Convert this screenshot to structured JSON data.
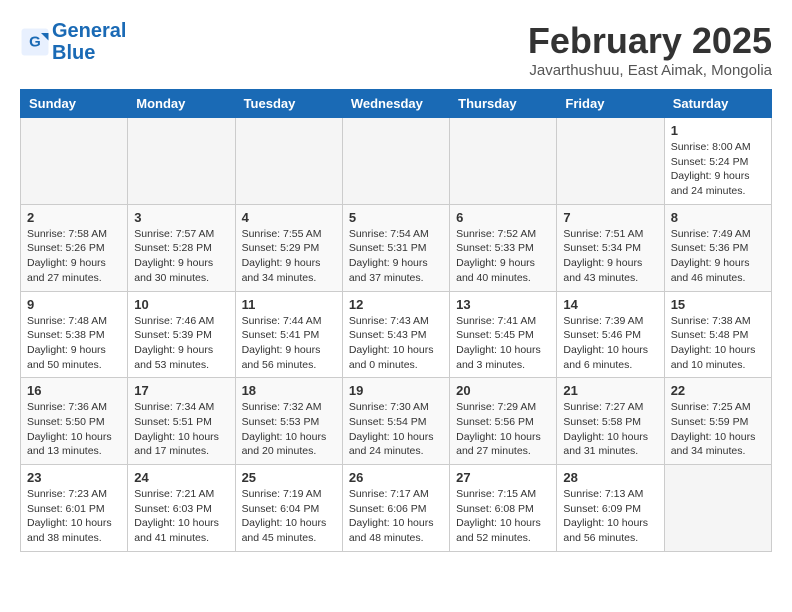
{
  "header": {
    "logo_line1": "General",
    "logo_line2": "Blue",
    "title": "February 2025",
    "subtitle": "Javarthushuu, East Aimak, Mongolia"
  },
  "weekdays": [
    "Sunday",
    "Monday",
    "Tuesday",
    "Wednesday",
    "Thursday",
    "Friday",
    "Saturday"
  ],
  "weeks": [
    [
      {
        "day": "",
        "info": ""
      },
      {
        "day": "",
        "info": ""
      },
      {
        "day": "",
        "info": ""
      },
      {
        "day": "",
        "info": ""
      },
      {
        "day": "",
        "info": ""
      },
      {
        "day": "",
        "info": ""
      },
      {
        "day": "1",
        "info": "Sunrise: 8:00 AM\nSunset: 5:24 PM\nDaylight: 9 hours and 24 minutes."
      }
    ],
    [
      {
        "day": "2",
        "info": "Sunrise: 7:58 AM\nSunset: 5:26 PM\nDaylight: 9 hours and 27 minutes."
      },
      {
        "day": "3",
        "info": "Sunrise: 7:57 AM\nSunset: 5:28 PM\nDaylight: 9 hours and 30 minutes."
      },
      {
        "day": "4",
        "info": "Sunrise: 7:55 AM\nSunset: 5:29 PM\nDaylight: 9 hours and 34 minutes."
      },
      {
        "day": "5",
        "info": "Sunrise: 7:54 AM\nSunset: 5:31 PM\nDaylight: 9 hours and 37 minutes."
      },
      {
        "day": "6",
        "info": "Sunrise: 7:52 AM\nSunset: 5:33 PM\nDaylight: 9 hours and 40 minutes."
      },
      {
        "day": "7",
        "info": "Sunrise: 7:51 AM\nSunset: 5:34 PM\nDaylight: 9 hours and 43 minutes."
      },
      {
        "day": "8",
        "info": "Sunrise: 7:49 AM\nSunset: 5:36 PM\nDaylight: 9 hours and 46 minutes."
      }
    ],
    [
      {
        "day": "9",
        "info": "Sunrise: 7:48 AM\nSunset: 5:38 PM\nDaylight: 9 hours and 50 minutes."
      },
      {
        "day": "10",
        "info": "Sunrise: 7:46 AM\nSunset: 5:39 PM\nDaylight: 9 hours and 53 minutes."
      },
      {
        "day": "11",
        "info": "Sunrise: 7:44 AM\nSunset: 5:41 PM\nDaylight: 9 hours and 56 minutes."
      },
      {
        "day": "12",
        "info": "Sunrise: 7:43 AM\nSunset: 5:43 PM\nDaylight: 10 hours and 0 minutes."
      },
      {
        "day": "13",
        "info": "Sunrise: 7:41 AM\nSunset: 5:45 PM\nDaylight: 10 hours and 3 minutes."
      },
      {
        "day": "14",
        "info": "Sunrise: 7:39 AM\nSunset: 5:46 PM\nDaylight: 10 hours and 6 minutes."
      },
      {
        "day": "15",
        "info": "Sunrise: 7:38 AM\nSunset: 5:48 PM\nDaylight: 10 hours and 10 minutes."
      }
    ],
    [
      {
        "day": "16",
        "info": "Sunrise: 7:36 AM\nSunset: 5:50 PM\nDaylight: 10 hours and 13 minutes."
      },
      {
        "day": "17",
        "info": "Sunrise: 7:34 AM\nSunset: 5:51 PM\nDaylight: 10 hours and 17 minutes."
      },
      {
        "day": "18",
        "info": "Sunrise: 7:32 AM\nSunset: 5:53 PM\nDaylight: 10 hours and 20 minutes."
      },
      {
        "day": "19",
        "info": "Sunrise: 7:30 AM\nSunset: 5:54 PM\nDaylight: 10 hours and 24 minutes."
      },
      {
        "day": "20",
        "info": "Sunrise: 7:29 AM\nSunset: 5:56 PM\nDaylight: 10 hours and 27 minutes."
      },
      {
        "day": "21",
        "info": "Sunrise: 7:27 AM\nSunset: 5:58 PM\nDaylight: 10 hours and 31 minutes."
      },
      {
        "day": "22",
        "info": "Sunrise: 7:25 AM\nSunset: 5:59 PM\nDaylight: 10 hours and 34 minutes."
      }
    ],
    [
      {
        "day": "23",
        "info": "Sunrise: 7:23 AM\nSunset: 6:01 PM\nDaylight: 10 hours and 38 minutes."
      },
      {
        "day": "24",
        "info": "Sunrise: 7:21 AM\nSunset: 6:03 PM\nDaylight: 10 hours and 41 minutes."
      },
      {
        "day": "25",
        "info": "Sunrise: 7:19 AM\nSunset: 6:04 PM\nDaylight: 10 hours and 45 minutes."
      },
      {
        "day": "26",
        "info": "Sunrise: 7:17 AM\nSunset: 6:06 PM\nDaylight: 10 hours and 48 minutes."
      },
      {
        "day": "27",
        "info": "Sunrise: 7:15 AM\nSunset: 6:08 PM\nDaylight: 10 hours and 52 minutes."
      },
      {
        "day": "28",
        "info": "Sunrise: 7:13 AM\nSunset: 6:09 PM\nDaylight: 10 hours and 56 minutes."
      },
      {
        "day": "",
        "info": ""
      }
    ]
  ]
}
